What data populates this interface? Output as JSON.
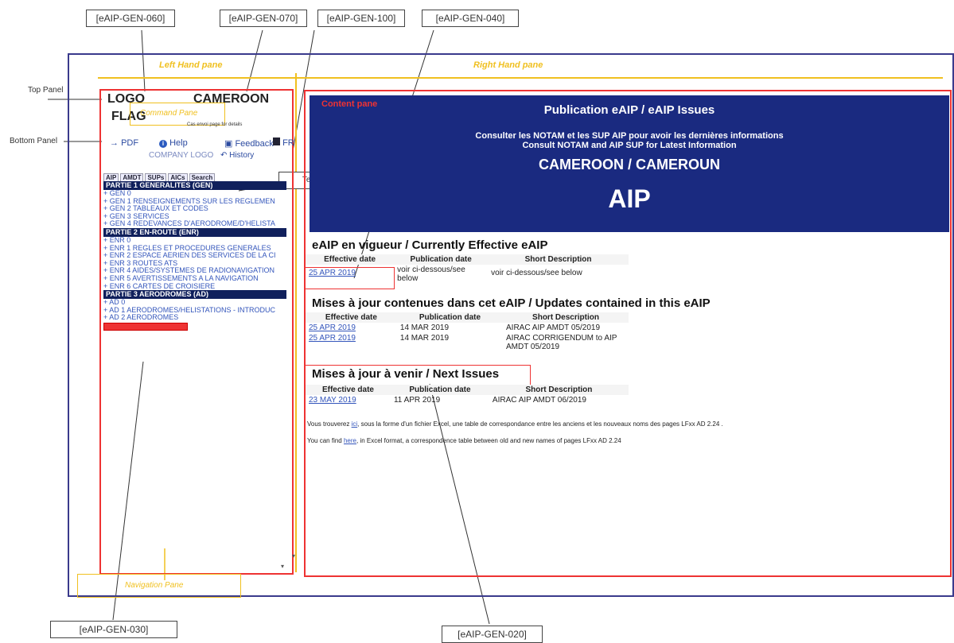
{
  "callouts": {
    "gen060": "[eAIP-GEN-060]",
    "gen070": "[eAIP-GEN-070]",
    "gen100": "[eAIP-GEN-100]",
    "gen040": "[eAIP-GEN-040]",
    "gen030": "[eAIP-GEN-030]",
    "gen020": "[eAIP-GEN-020]",
    "text": "Text"
  },
  "side_labels": {
    "top_panel": "Top Panel",
    "bottom_panel": "Bottom Panel"
  },
  "pane_labels": {
    "left_hand": "Left Hand pane",
    "right_hand": "Right Hand pane",
    "content": "Content pane",
    "command": "Command Pane",
    "navigation": "Navigation Pane"
  },
  "left_pane": {
    "logo": "LOGO",
    "country": "CAMEROON",
    "flag": "FLAG",
    "tiny_note": "Cas envoi page for details",
    "pdf": "PDF",
    "help": "Help",
    "feedback": "Feedback",
    "fr": "FR",
    "company_logo": "COMPANY LOGO",
    "history": "History",
    "tabs": [
      "AIP",
      "AMDT",
      "SUPs",
      "AICs",
      "Search"
    ],
    "part1": "PARTIE 1 GENERALITES (GEN)",
    "gen_items": [
      "+ GEN 0",
      "+ GEN 1 RENSEIGNEMENTS SUR LES REGLEMEN",
      "+ GEN 2 TABLEAUX ET CODES",
      "+ GEN 3 SERVICES",
      "+ GEN 4 REDEVANCES D'AERODROME/D'HELISTA"
    ],
    "part2": "PARTIE 2 EN-ROUTE (ENR)",
    "enr_items": [
      "+ ENR 0",
      "+ ENR 1 REGLES ET PROCEDURES GENERALES",
      "+ ENR 2 ESPACE AERIEN DES SERVICES DE LA CI",
      "+ ENR 3 ROUTES ATS",
      "+ ENR 4 AIDES/SYSTEMES DE RADIONAVIGATION",
      "+ ENR 5 AVERTISSEMENTS A LA NAVIGATION",
      "+ ENR 6 CARTES DE CROISIERE"
    ],
    "part3": "PARTIE 3 AERODROMES (AD)",
    "ad_items": [
      "+ AD 0",
      "+ AD 1 AERODROMES/HELISTATIONS - INTRODUC",
      "+ AD 2 AERODROMES"
    ]
  },
  "banner": {
    "title": "Publication eAIP / eAIP Issues",
    "line1": "Consulter les NOTAM et les SUP AIP pour avoir les dernières informations",
    "line2": "Consult NOTAM and AIP SUP for Latest Information",
    "country": "CAMEROON / CAMEROUN",
    "aip": "AIP"
  },
  "current": {
    "heading": "eAIP en vigueur / Currently Effective eAIP",
    "headers": [
      "Effective date",
      "Publication date",
      "Short Description"
    ],
    "row": [
      "25 APR 2019",
      "voir ci-dessous/see below",
      "voir ci-dessous/see below"
    ]
  },
  "updates": {
    "heading": "Mises à jour contenues dans cet eAIP / Updates contained in this eAIP",
    "headers": [
      "Effective date",
      "Publication date",
      "Short Description"
    ],
    "rows": [
      [
        "25 APR 2019",
        "14 MAR 2019",
        "AIRAC AIP AMDT 05/2019"
      ],
      [
        "25 APR 2019",
        "14 MAR 2019",
        "AIRAC CORRIGENDUM to AIP AMDT 05/2019"
      ]
    ]
  },
  "next": {
    "heading": "Mises à jour à venir / Next Issues",
    "headers": [
      "Effective date",
      "Publication date",
      "Short Description"
    ],
    "row": [
      "23 MAY 2019",
      "11 APR 2019",
      "AIRAC AIP AMDT 06/2019"
    ]
  },
  "notes": {
    "fr_pre": "Vous trouverez",
    "fr_link": "ici",
    "fr_post": ", sous la forme d'un fichier Excel, une table de correspondance entre les anciens et les nouveaux noms des pages LFxx AD 2.24 .",
    "en_pre": "You can find",
    "en_link": "here",
    "en_post": ", in Excel format, a correspondence table between old and new names of pages LFxx AD 2.24"
  },
  "colors": {
    "banner": "#1a2a80",
    "highlight": "#e33333",
    "yellow": "#f0c020",
    "frame": "#3a3a8c"
  }
}
